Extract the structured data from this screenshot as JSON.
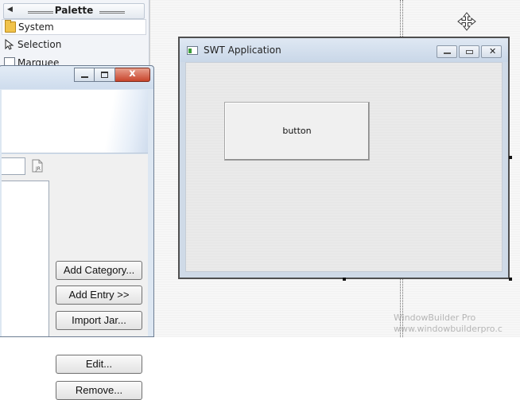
{
  "palette": {
    "title": "Palette",
    "items": [
      {
        "label": "System",
        "icon": "folder-icon"
      },
      {
        "label": "Selection",
        "icon": "selection-arrow-icon"
      },
      {
        "label": "Marquee",
        "icon": "marquee-icon"
      }
    ]
  },
  "shell": {
    "title": "SWT Application",
    "button_label": "button"
  },
  "dialog": {
    "buttons": [
      "Add Category...",
      "Add Entry >>",
      "Import Jar...",
      "Edit...",
      "Remove..."
    ],
    "close_glyph": "x"
  },
  "watermark": {
    "line1": "WindowBuilder Pro",
    "line2": "www.windowbuilderpro.c"
  },
  "colors": {
    "accent": "#cfdced",
    "close_button": "#c8452c"
  }
}
